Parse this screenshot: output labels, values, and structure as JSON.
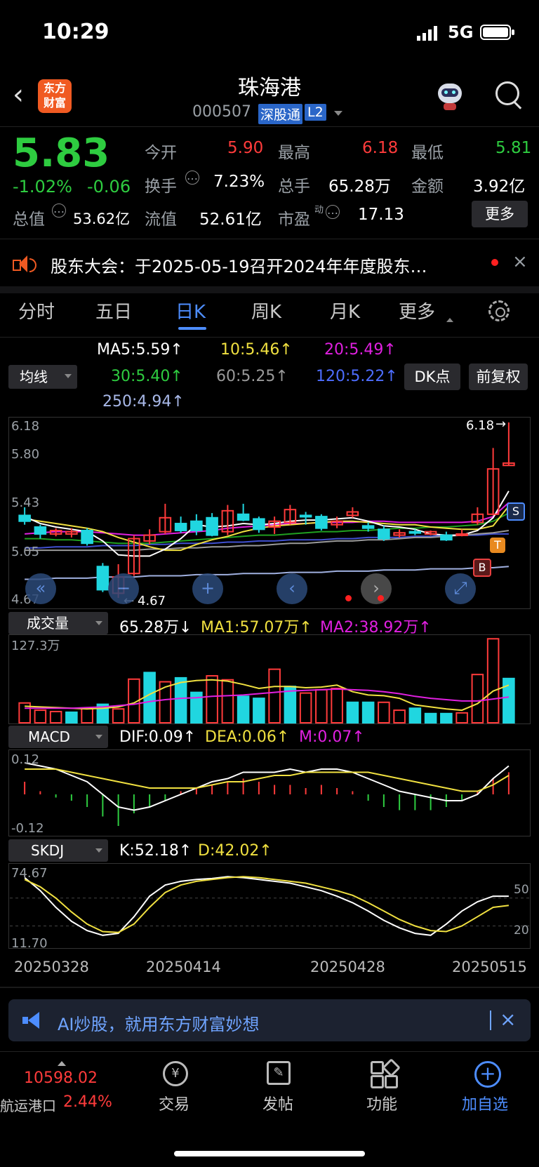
{
  "status_bar": {
    "time": "10:29",
    "network": "5G"
  },
  "header": {
    "title": "珠海港",
    "code": "000507",
    "badge_connect": "深股通",
    "badge_level": "L2",
    "logo_line1": "东方",
    "logo_line2": "财富"
  },
  "quote": {
    "price": "5.83",
    "change_pct": "-1.02%",
    "change_amt": "-0.06",
    "market_value_label": "总值",
    "market_value": "53.62亿",
    "stats": [
      {
        "label": "今开",
        "value": "5.90"
      },
      {
        "label": "最高",
        "value": "6.18"
      },
      {
        "label": "最低",
        "value": "5.81"
      },
      {
        "label": "换手",
        "value": "7.23%"
      },
      {
        "label": "总手",
        "value": "65.28万"
      },
      {
        "label": "金额",
        "value": "3.92亿"
      },
      {
        "label": "流值",
        "value": "52.61亿"
      },
      {
        "label": "市盈",
        "sup": "动",
        "value": "17.13"
      }
    ],
    "more_label": "更多"
  },
  "notice": {
    "text": "股东大会：于2025-05-19召开2024年年度股东…"
  },
  "tabs": [
    "分时",
    "五日",
    "日K",
    "周K",
    "月K",
    "更多"
  ],
  "active_tab": "日K",
  "ma": {
    "dropdown": "均线",
    "ma5": "MA5:5.59↑",
    "ma10": "10:5.46↑",
    "ma20": "20:5.49↑",
    "ma30": "30:5.40↑",
    "ma60": "60:5.25↑",
    "ma120": "120:5.22↑",
    "ma250": "250:4.94↑",
    "dk_label": "DK点",
    "fq_label": "前复权"
  },
  "kline_axis": {
    "y_labels": [
      "6.18",
      "5.80",
      "5.43",
      "5.05",
      "4.67"
    ],
    "high_mark": "6.18",
    "low_mark": "4.67"
  },
  "volume": {
    "dropdown": "成交量",
    "vol": "65.28万↓",
    "ma1": "MA1:57.07万↑",
    "ma2": "MA2:38.92万↑",
    "y_max": "127.3万"
  },
  "macd": {
    "dropdown": "MACD",
    "dif": "DIF:0.09↑",
    "dea": "DEA:0.06↑",
    "m": "M:0.07↑",
    "y_top": "0.12",
    "y_bottom": "-0.12"
  },
  "skdj": {
    "dropdown": "SKDJ",
    "k": "K:52.18↑",
    "d": "D:42.02↑",
    "y_top": "74.67",
    "y_bottom": "11.70",
    "ref_high": "50",
    "ref_low": "20"
  },
  "dates": [
    "20250328",
    "20250414",
    "20250428",
    "20250515"
  ],
  "markers": {
    "s": "S",
    "t": "T",
    "b": "B"
  },
  "ad_banner": {
    "text": "AI炒股，就用东方财富妙想"
  },
  "bottom_nav": {
    "index_value": "10598.02",
    "index_name": "航运港口",
    "index_change": "2.44%",
    "items": [
      "交易",
      "发帖",
      "功能",
      "加自选"
    ]
  },
  "colors": {
    "up": "#ff3b3b",
    "down": "#2ecc40",
    "candle_down": "#20d6e0",
    "accent": "#4d8dff",
    "ma5": "#ffffff",
    "ma10": "#f0e040",
    "ma20": "#e020e0",
    "ma30": "#20a020",
    "ma60": "#9a9a9a",
    "ma120": "#4050d0",
    "ma250": "#a0b0e0"
  },
  "chart_data": [
    {
      "type": "candlestick",
      "title": "",
      "ylim": [
        4.67,
        6.18
      ],
      "x_ticks": [
        "20250328",
        "20250414",
        "20250428",
        "20250515"
      ],
      "candles": [
        {
          "o": 5.38,
          "c": 5.33,
          "h": 5.45,
          "l": 5.3
        },
        {
          "o": 5.28,
          "c": 5.22,
          "h": 5.3,
          "l": 5.18
        },
        {
          "o": 5.22,
          "c": 5.25,
          "h": 5.27,
          "l": 5.2
        },
        {
          "o": 5.22,
          "c": 5.24,
          "h": 5.27,
          "l": 5.19
        },
        {
          "o": 5.25,
          "c": 5.14,
          "h": 5.27,
          "l": 5.12
        },
        {
          "o": 4.94,
          "c": 4.74,
          "h": 4.97,
          "l": 4.72
        },
        {
          "o": 4.71,
          "c": 4.85,
          "h": 4.96,
          "l": 4.67
        },
        {
          "o": 4.88,
          "c": 5.18,
          "h": 5.21,
          "l": 4.86
        },
        {
          "o": 5.16,
          "c": 5.21,
          "h": 5.26,
          "l": 5.13
        },
        {
          "o": 5.24,
          "c": 5.36,
          "h": 5.48,
          "l": 5.22
        },
        {
          "o": 5.31,
          "c": 5.25,
          "h": 5.37,
          "l": 5.23
        },
        {
          "o": 5.33,
          "c": 5.25,
          "h": 5.39,
          "l": 5.21
        },
        {
          "o": 5.36,
          "c": 5.21,
          "h": 5.4,
          "l": 5.2
        },
        {
          "o": 5.24,
          "c": 5.42,
          "h": 5.47,
          "l": 5.21
        },
        {
          "o": 5.39,
          "c": 5.34,
          "h": 5.48,
          "l": 5.33
        },
        {
          "o": 5.35,
          "c": 5.26,
          "h": 5.37,
          "l": 5.23
        },
        {
          "o": 5.28,
          "c": 5.33,
          "h": 5.37,
          "l": 5.22
        },
        {
          "o": 5.32,
          "c": 5.43,
          "h": 5.47,
          "l": 5.3
        },
        {
          "o": 5.38,
          "c": 5.37,
          "h": 5.41,
          "l": 5.3
        },
        {
          "o": 5.37,
          "c": 5.27,
          "h": 5.39,
          "l": 5.25
        },
        {
          "o": 5.3,
          "c": 5.33,
          "h": 5.37,
          "l": 5.27
        },
        {
          "o": 5.38,
          "c": 5.41,
          "h": 5.45,
          "l": 5.36
        },
        {
          "o": 5.29,
          "c": 5.27,
          "h": 5.32,
          "l": 5.24
        },
        {
          "o": 5.26,
          "c": 5.18,
          "h": 5.29,
          "l": 5.16
        },
        {
          "o": 5.21,
          "c": 5.23,
          "h": 5.26,
          "l": 5.19
        },
        {
          "o": 5.24,
          "c": 5.23,
          "h": 5.26,
          "l": 5.21
        },
        {
          "o": 5.22,
          "c": 5.24,
          "h": 5.25,
          "l": 5.21
        },
        {
          "o": 5.21,
          "c": 5.17,
          "h": 5.24,
          "l": 5.16
        },
        {
          "o": 5.21,
          "c": 5.22,
          "h": 5.26,
          "l": 5.2
        },
        {
          "o": 5.32,
          "c": 5.39,
          "h": 5.45,
          "l": 5.3
        },
        {
          "o": 5.39,
          "c": 5.78,
          "h": 5.96,
          "l": 5.38
        },
        {
          "o": 5.81,
          "c": 5.83,
          "h": 6.18,
          "l": 5.81
        }
      ],
      "series": [
        {
          "name": "MA5",
          "values": [
            5.37,
            5.31,
            5.28,
            5.26,
            5.24,
            5.16,
            5.04,
            5.03,
            5.03,
            5.09,
            5.18,
            5.3,
            5.28,
            5.29,
            5.31,
            5.3,
            5.31,
            5.33,
            5.34,
            5.34,
            5.35,
            5.36,
            5.33,
            5.29,
            5.28,
            5.26,
            5.22,
            5.21,
            5.21,
            5.25,
            5.36,
            5.59
          ]
        },
        {
          "name": "10",
          "values": [
            5.35,
            5.33,
            5.31,
            5.29,
            5.27,
            5.24,
            5.19,
            5.15,
            5.11,
            5.08,
            5.08,
            5.13,
            5.17,
            5.2,
            5.24,
            5.27,
            5.29,
            5.3,
            5.31,
            5.32,
            5.33,
            5.33,
            5.32,
            5.31,
            5.3,
            5.3,
            5.28,
            5.27,
            5.26,
            5.26,
            5.29,
            5.46
          ]
        },
        {
          "name": "20",
          "values": [
            5.22,
            5.23,
            5.24,
            5.24,
            5.24,
            5.23,
            5.22,
            5.21,
            5.21,
            5.22,
            5.23,
            5.24,
            5.25,
            5.27,
            5.28,
            5.29,
            5.3,
            5.31,
            5.31,
            5.32,
            5.32,
            5.32,
            5.33,
            5.33,
            5.32,
            5.32,
            5.32,
            5.32,
            5.32,
            5.33,
            5.37,
            5.49
          ]
        },
        {
          "name": "30",
          "values": [
            5.18,
            5.18,
            5.17,
            5.17,
            5.16,
            5.15,
            5.14,
            5.14,
            5.14,
            5.15,
            5.16,
            5.17,
            5.18,
            5.19,
            5.2,
            5.21,
            5.21,
            5.22,
            5.23,
            5.24,
            5.24,
            5.25,
            5.25,
            5.26,
            5.27,
            5.27,
            5.28,
            5.28,
            5.29,
            5.3,
            5.33,
            5.4
          ]
        },
        {
          "name": "60",
          "values": [
            5.08,
            5.08,
            5.08,
            5.08,
            5.08,
            5.08,
            5.08,
            5.08,
            5.09,
            5.09,
            5.1,
            5.1,
            5.11,
            5.11,
            5.12,
            5.12,
            5.13,
            5.14,
            5.14,
            5.15,
            5.16,
            5.16,
            5.17,
            5.17,
            5.18,
            5.19,
            5.19,
            5.2,
            5.21,
            5.22,
            5.23,
            5.25
          ]
        },
        {
          "name": "120",
          "values": [
            5.1,
            5.1,
            5.11,
            5.11,
            5.11,
            5.12,
            5.12,
            5.12,
            5.13,
            5.13,
            5.14,
            5.14,
            5.14,
            5.15,
            5.15,
            5.16,
            5.16,
            5.17,
            5.17,
            5.17,
            5.18,
            5.18,
            5.19,
            5.19,
            5.19,
            5.2,
            5.2,
            5.21,
            5.21,
            5.21,
            5.22,
            5.22
          ]
        },
        {
          "name": "250",
          "values": [
            4.83,
            4.83,
            4.84,
            4.84,
            4.84,
            4.85,
            4.85,
            4.85,
            4.86,
            4.86,
            4.86,
            4.87,
            4.87,
            4.87,
            4.88,
            4.88,
            4.88,
            4.89,
            4.89,
            4.89,
            4.9,
            4.9,
            4.9,
            4.91,
            4.91,
            4.91,
            4.92,
            4.92,
            4.92,
            4.93,
            4.93,
            4.94
          ]
        }
      ]
    },
    {
      "type": "bar",
      "title": "成交量",
      "ylim": [
        0,
        127.3
      ],
      "values": [
        30,
        19,
        17,
        16,
        22,
        28,
        21,
        66,
        76,
        62,
        68,
        46,
        71,
        65,
        40,
        37,
        81,
        55,
        45,
        50,
        52,
        31,
        31,
        31,
        19,
        22,
        14,
        14,
        15,
        73,
        127,
        67
      ],
      "up": [
        true,
        true,
        true,
        false,
        true,
        false,
        true,
        true,
        false,
        true,
        false,
        false,
        true,
        true,
        false,
        false,
        true,
        false,
        true,
        true,
        true,
        false,
        false,
        true,
        true,
        false,
        false,
        false,
        true,
        true,
        true,
        false
      ],
      "series": [
        {
          "name": "MA1",
          "values": [
            25,
            24,
            23,
            22,
            21,
            22,
            24,
            30,
            43,
            54,
            61,
            64,
            65,
            63,
            58,
            52,
            55,
            55,
            53,
            54,
            57,
            47,
            42,
            41,
            37,
            27,
            24,
            21,
            19,
            29,
            48,
            57
          ]
        },
        {
          "name": "MA2",
          "values": [
            22,
            22,
            22,
            22,
            23,
            24,
            26,
            28,
            32,
            35,
            37,
            38,
            40,
            41,
            42,
            44,
            46,
            48,
            49,
            50,
            51,
            50,
            49,
            47,
            44,
            40,
            37,
            35,
            33,
            33,
            36,
            39
          ]
        }
      ]
    },
    {
      "type": "bar",
      "title": "MACD",
      "ylim": [
        -0.12,
        0.12
      ],
      "values": [
        0.04,
        0.01,
        -0.01,
        -0.02,
        -0.04,
        -0.07,
        -0.1,
        -0.06,
        -0.04,
        -0.02,
        0.01,
        0.02,
        0.03,
        0.04,
        0.05,
        0.04,
        0.03,
        0.03,
        0.02,
        0.03,
        0.02,
        0.01,
        -0.02,
        -0.04,
        -0.05,
        -0.05,
        -0.05,
        -0.04,
        -0.02,
        0.01,
        0.05,
        0.07
      ],
      "series": [
        {
          "name": "DIF",
          "values": [
            0.1,
            0.09,
            0.08,
            0.06,
            0.04,
            0.0,
            -0.04,
            -0.05,
            -0.04,
            -0.02,
            0.0,
            0.02,
            0.04,
            0.05,
            0.07,
            0.07,
            0.07,
            0.08,
            0.07,
            0.08,
            0.08,
            0.07,
            0.05,
            0.03,
            0.01,
            0.0,
            -0.01,
            -0.02,
            -0.02,
            0.0,
            0.05,
            0.09
          ]
        },
        {
          "name": "DEA",
          "values": [
            0.08,
            0.08,
            0.08,
            0.07,
            0.06,
            0.05,
            0.04,
            0.03,
            0.02,
            0.02,
            0.02,
            0.02,
            0.03,
            0.04,
            0.04,
            0.05,
            0.06,
            0.06,
            0.07,
            0.07,
            0.07,
            0.07,
            0.07,
            0.06,
            0.05,
            0.04,
            0.03,
            0.02,
            0.01,
            0.01,
            0.03,
            0.06
          ]
        }
      ]
    },
    {
      "type": "line",
      "title": "SKDJ",
      "ylim": [
        11.7,
        74.67
      ],
      "series": [
        {
          "name": "K",
          "values": [
            72,
            58,
            40,
            25,
            15,
            10,
            12,
            30,
            52,
            64,
            68,
            70,
            71,
            73,
            72,
            70,
            68,
            66,
            62,
            58,
            52,
            45,
            36,
            26,
            18,
            12,
            10,
            22,
            36,
            46,
            52,
            52
          ]
        },
        {
          "name": "D",
          "values": [
            70,
            62,
            50,
            35,
            22,
            14,
            13,
            22,
            40,
            56,
            64,
            68,
            70,
            72,
            73,
            72,
            70,
            68,
            66,
            62,
            58,
            53,
            45,
            36,
            27,
            20,
            15,
            14,
            20,
            30,
            40,
            42
          ]
        }
      ]
    }
  ]
}
